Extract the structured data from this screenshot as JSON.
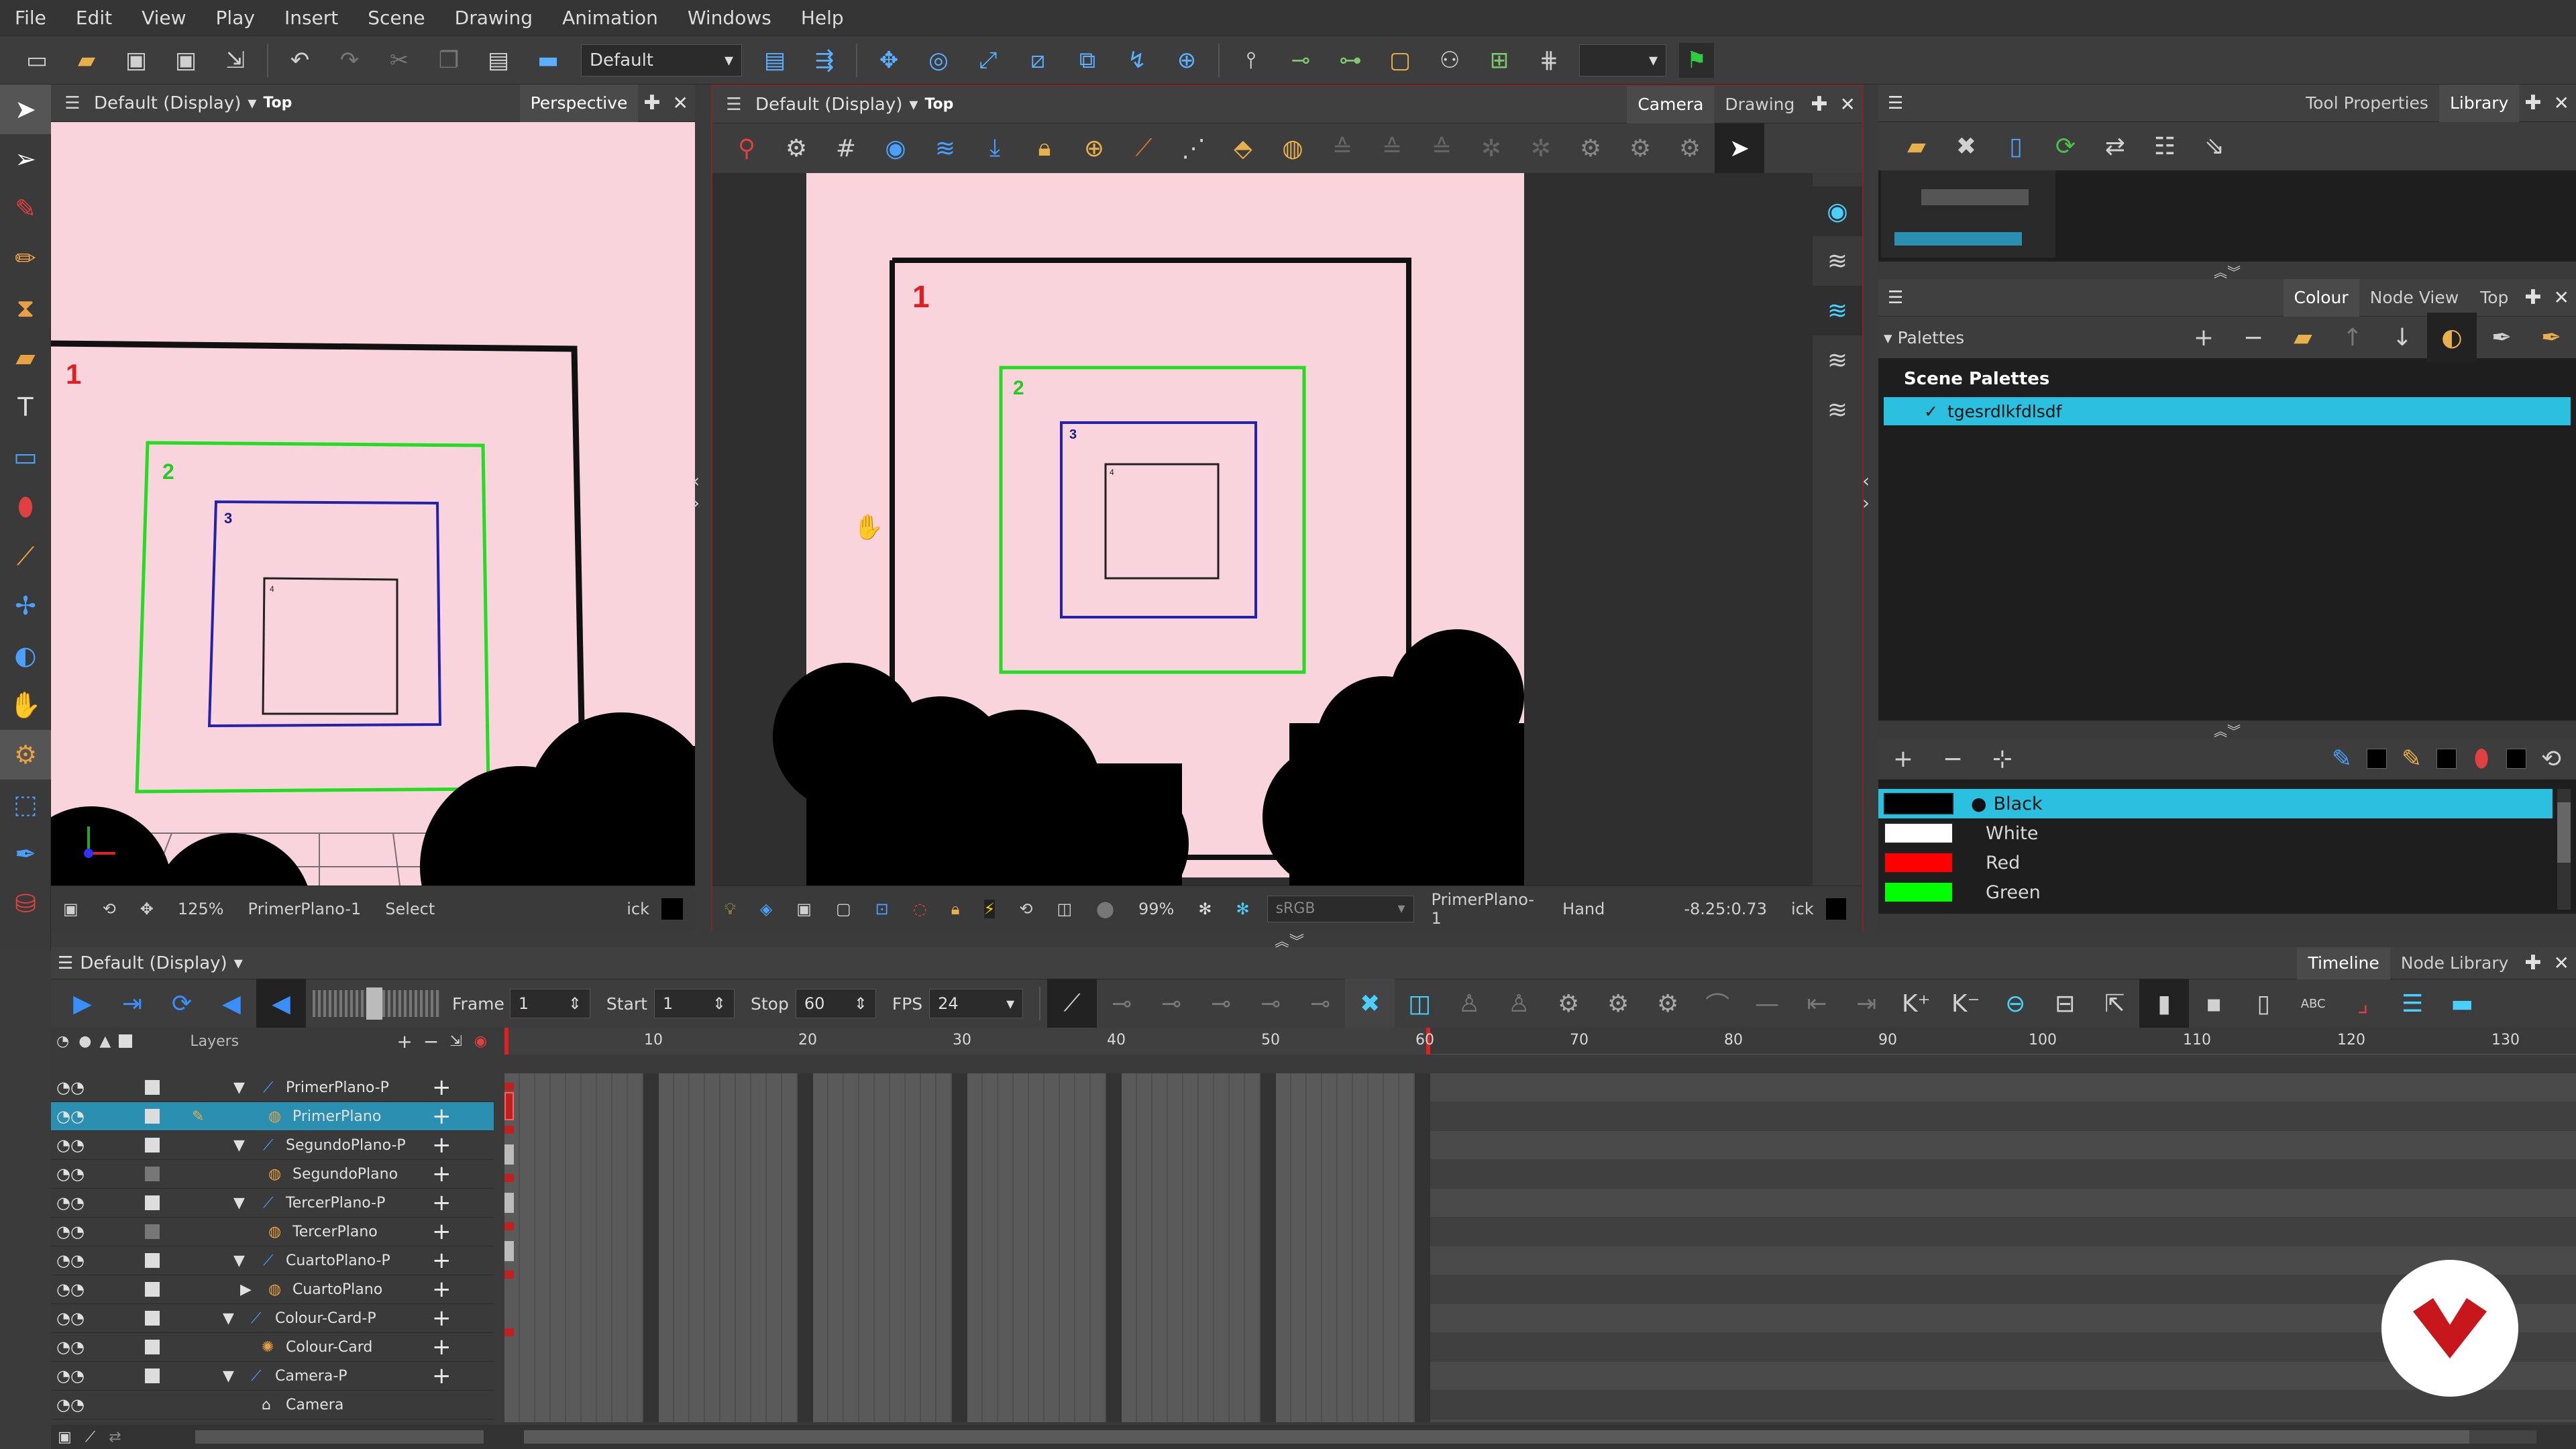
{
  "menu": [
    "File",
    "Edit",
    "View",
    "Play",
    "Insert",
    "Scene",
    "Drawing",
    "Animation",
    "Windows",
    "Help"
  ],
  "toolbar": {
    "workspace_combo": "Default"
  },
  "left_view": {
    "view_label": "Default (Display)",
    "view_mode": "Top",
    "tab": "Perspective",
    "zoom": "125%",
    "layer": "PrimerPlano-1",
    "tool": "Select",
    "ick": "ick"
  },
  "center_view": {
    "view_label": "Default (Display)",
    "view_mode": "Top",
    "tabs": [
      "Camera",
      "Drawing"
    ],
    "zoom": "99%",
    "color_space": "sRGB",
    "layer": "PrimerPlano-1",
    "tool": "Hand",
    "coords": "-8.25:0.73",
    "ick": "ick"
  },
  "square_labels": [
    "1",
    "2",
    "3",
    "4"
  ],
  "right_top": {
    "tabs": [
      "Tool Properties",
      "Library"
    ]
  },
  "colour_panel": {
    "tabs": [
      "Colour",
      "Node View",
      "Top"
    ],
    "palettes_label": "Palettes",
    "scene_palettes": "Scene Palettes",
    "palette_name": "tgesrdlkfdlsdf",
    "colours": [
      {
        "name": "Black",
        "hex": "#000000"
      },
      {
        "name": "White",
        "hex": "#ffffff"
      },
      {
        "name": "Red",
        "hex": "#ff0000"
      },
      {
        "name": "Green",
        "hex": "#00ff00"
      }
    ]
  },
  "timeline": {
    "view_label": "Default (Display)",
    "tabs": [
      "Timeline",
      "Node Library"
    ],
    "frame_label": "Frame",
    "frame": "1",
    "start_label": "Start",
    "start": "1",
    "stop_label": "Stop",
    "stop": "60",
    "fps_label": "FPS",
    "fps": "24",
    "layers_label": "Layers",
    "ruler": [
      "10",
      "20",
      "30",
      "40",
      "50",
      "60",
      "70",
      "80",
      "90",
      "100",
      "110",
      "120",
      "130"
    ],
    "layers": [
      {
        "name": "PrimerPlano-P",
        "type": "peg",
        "indent": 0
      },
      {
        "name": "PrimerPlano",
        "type": "drawing",
        "indent": 1,
        "selected": true
      },
      {
        "name": "SegundoPlano-P",
        "type": "peg",
        "indent": 0
      },
      {
        "name": "SegundoPlano",
        "type": "drawing",
        "indent": 1
      },
      {
        "name": "TercerPlano-P",
        "type": "peg",
        "indent": 0
      },
      {
        "name": "TercerPlano",
        "type": "drawing",
        "indent": 1
      },
      {
        "name": "CuartoPlano-P",
        "type": "peg",
        "indent": 0
      },
      {
        "name": "CuartoPlano",
        "type": "drawing",
        "indent": 1
      },
      {
        "name": "Colour-Card-P",
        "type": "peg",
        "indent": 0
      },
      {
        "name": "Colour-Card",
        "type": "colourcard",
        "indent": 1
      },
      {
        "name": "Camera-P",
        "type": "peg",
        "indent": 0
      },
      {
        "name": "Camera",
        "type": "camera",
        "indent": 1
      }
    ]
  },
  "colors": {
    "accent": "#29b6d9",
    "canvas": "#fad4dc",
    "frame_red": "#e02020"
  }
}
